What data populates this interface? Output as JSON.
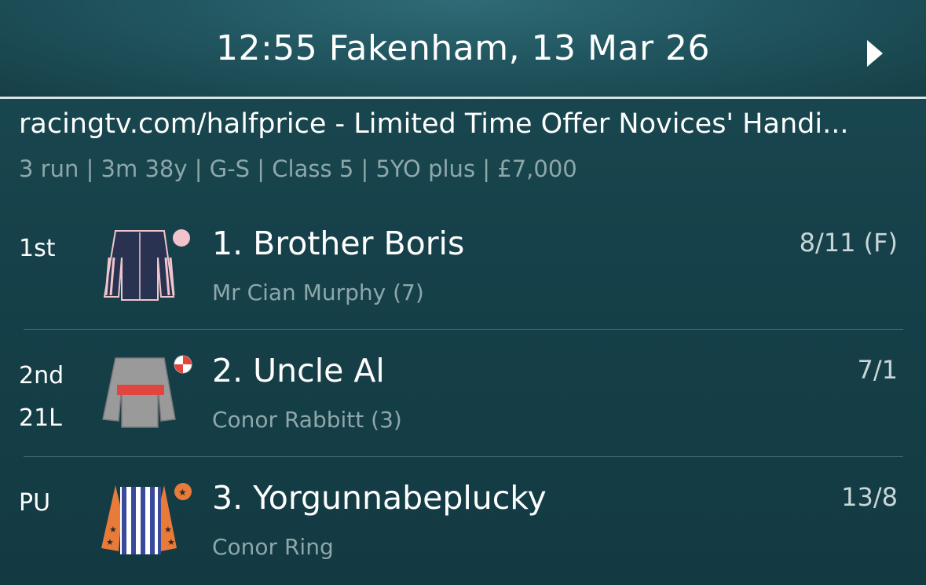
{
  "header": {
    "title": "12:55 Fakenham, 13 Mar 26",
    "next_icon": "play-triangle-right"
  },
  "race": {
    "name": "racingtv.com/halfprice - Limited Time Offer Novices' Handi...",
    "details": "3 run | 3m 38y | G-S | Class 5 | 5YO plus | £7,000"
  },
  "runners": [
    {
      "position": "1st",
      "distance": "",
      "name": "1. Brother Boris",
      "jockey": "Mr Cian Murphy (7)",
      "odds": "8/11 (F)",
      "silk": {
        "body": "#2a3252",
        "trim": "#f0c5cc",
        "cap": "#f3c3cc"
      }
    },
    {
      "position": "2nd",
      "distance": "21L",
      "name": "2. Uncle Al",
      "jockey": "Conor Rabbitt (3)",
      "odds": "7/1",
      "silk": {
        "body": "#9a9a9a",
        "hoop": "#e0463f",
        "cap_a": "#e0463f",
        "cap_b": "#ffffff"
      }
    },
    {
      "position": "PU",
      "distance": "",
      "name": "3. Yorgunnabeplucky",
      "jockey": "Conor Ring",
      "odds": "13/8",
      "silk": {
        "stripe_a": "#3a4a9a",
        "stripe_b": "#ffffff",
        "sleeves": "#e87a3a",
        "stars": "#2a2a2a"
      }
    }
  ],
  "colors": {
    "background": "#17434a",
    "header": "#215660",
    "muted_text": "#8ea7ab",
    "divider": "#3d6a71"
  }
}
